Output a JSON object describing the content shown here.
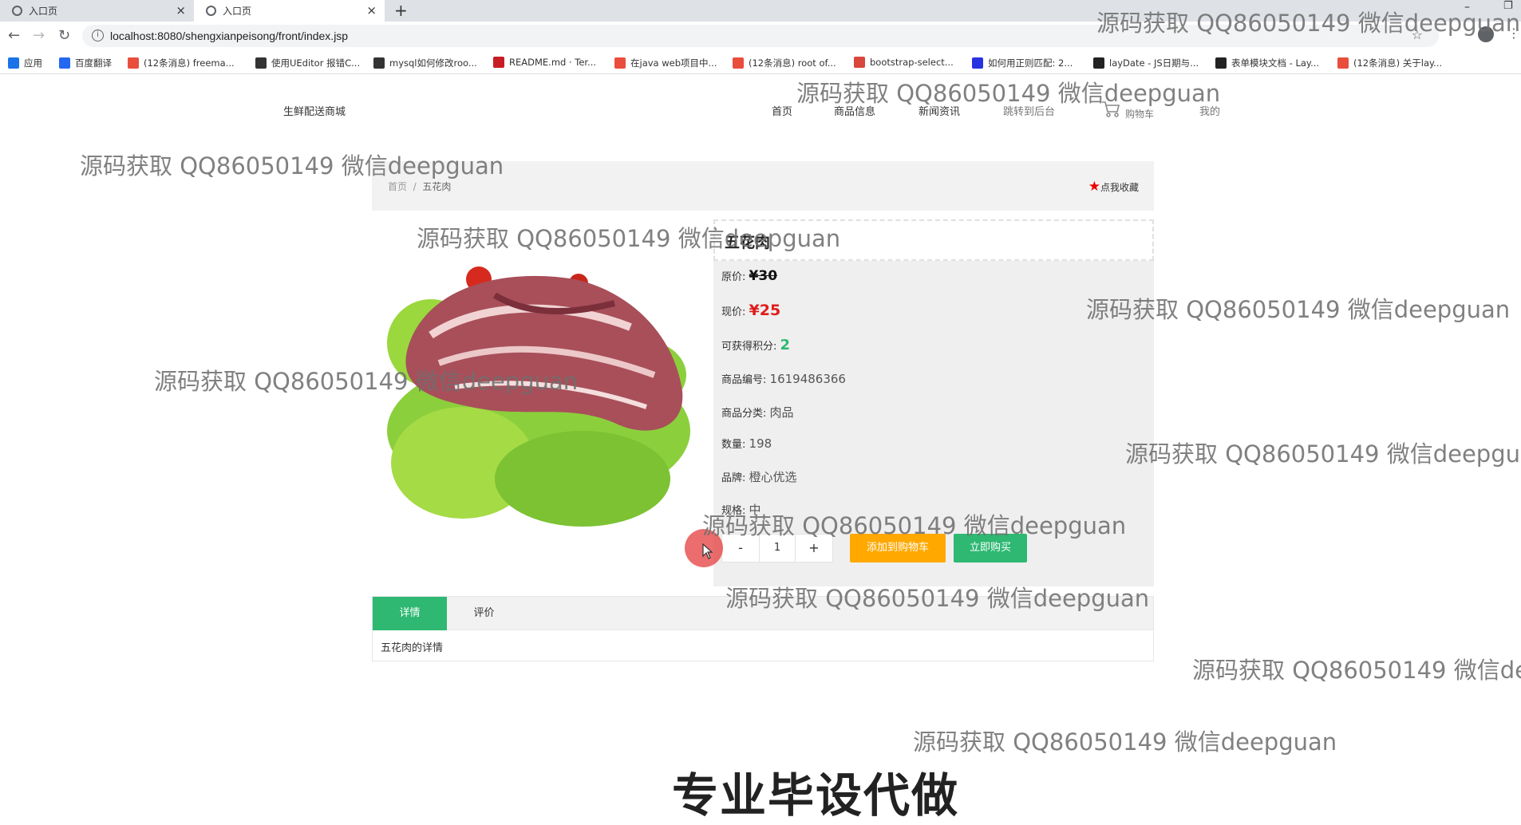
{
  "browser": {
    "tabs": [
      {
        "title": "入口页",
        "active": false
      },
      {
        "title": "入口页",
        "active": true
      }
    ],
    "new_tab": "+",
    "url": "localhost:8080/shengxianpeisong/front/index.jsp",
    "bookmarks": [
      {
        "label": "应用",
        "icon": "apps-grid-icon",
        "color": "#1a73e8"
      },
      {
        "label": "百度翻译",
        "icon": "baidu-translate-icon",
        "color": "#2468f2"
      },
      {
        "label": "(12条消息) freema...",
        "icon": "csdn-icon",
        "color": "#e94e3c"
      },
      {
        "label": "使用UEditor 报错C...",
        "icon": "ueditor-icon",
        "color": "#333333"
      },
      {
        "label": "mysql如何修改roo...",
        "icon": "ueditor-icon",
        "color": "#333333"
      },
      {
        "label": "README.md · Ter...",
        "icon": "gitee-icon",
        "color": "#c71d23"
      },
      {
        "label": "在java web项目中...",
        "icon": "csdn-icon",
        "color": "#e94e3c"
      },
      {
        "label": "(12条消息) root of...",
        "icon": "csdn-icon",
        "color": "#e94e3c"
      },
      {
        "label": "bootstrap-select...",
        "icon": "oschina-icon",
        "color": "#d9473c"
      },
      {
        "label": "如何用正则匹配: 2...",
        "icon": "baidu-icon",
        "color": "#2932e1"
      },
      {
        "label": "layDate - JS日期与...",
        "icon": "layui-icon",
        "color": "#222222"
      },
      {
        "label": "表单模块文档 - Lay...",
        "icon": "layui-icon",
        "color": "#222222"
      },
      {
        "label": "(12条消息) 关于lay...",
        "icon": "csdn-icon",
        "color": "#e94e3c"
      }
    ]
  },
  "header": {
    "site_title": "生鲜配送商城",
    "nav": [
      "首页",
      "商品信息",
      "新闻资讯",
      "跳转到后台",
      "购物车",
      "我的"
    ]
  },
  "breadcrumb": {
    "home": "首页",
    "sep": "/",
    "current": "五花肉"
  },
  "favorite_label": "点我收藏",
  "product": {
    "name": "五花肉",
    "original_price_label": "原价:",
    "original_price": "¥30",
    "price_label": "现价:",
    "price": "¥25",
    "points_label": "可获得积分:",
    "points": "2",
    "code_label": "商品编号:",
    "code": "1619486366",
    "category_label": "商品分类:",
    "category": "肉品",
    "quantity_label": "数量:",
    "quantity": "198",
    "brand_label": "品牌:",
    "brand": "橙心优选",
    "spec_label": "规格:",
    "spec": "中"
  },
  "purchase": {
    "minus": "-",
    "qty": "1",
    "plus": "+",
    "add_to_cart": "添加到购物车",
    "buy_now": "立即购买"
  },
  "tabs": {
    "items": [
      "详情",
      "评价"
    ],
    "content": "五花肉的详情"
  },
  "watermark": "源码获取 QQ86050149 微信deepguan",
  "caption": "专业毕设代做",
  "colors": {
    "accent_green": "#2eb872",
    "accent_orange": "#ffa800",
    "price_red": "#e01c1c"
  }
}
